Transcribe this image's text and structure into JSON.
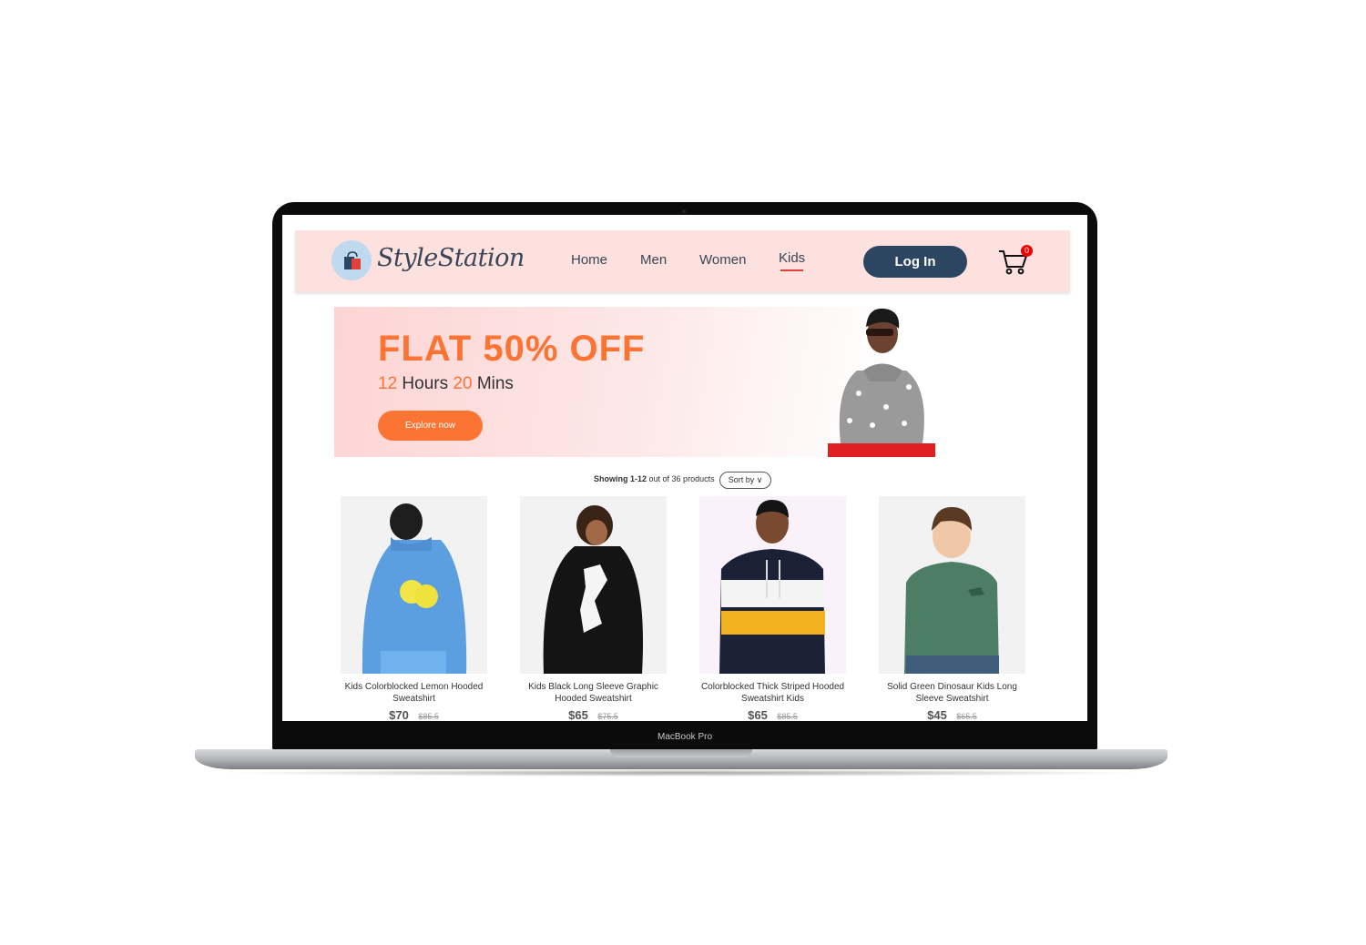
{
  "device": {
    "label": "MacBook Pro"
  },
  "navbar": {
    "brand": "StyleStation",
    "links": [
      {
        "label": "Home",
        "active": false
      },
      {
        "label": "Men",
        "active": false
      },
      {
        "label": "Women",
        "active": false
      },
      {
        "label": "Kids",
        "active": true
      }
    ],
    "login_label": "Log In",
    "cart_count": "0"
  },
  "banner": {
    "title": "FLAT 50% OFF",
    "hours": "12",
    "hours_label": "Hours",
    "mins": "20",
    "mins_label": "Mins",
    "cta": "Explore now"
  },
  "listing": {
    "showing_bold": "Showing 1-12",
    "showing_rest": "out of 36 products",
    "sort_label": "Sort by"
  },
  "products": [
    {
      "name": "Kids Colorblocked Lemon Hooded Sweatshirt",
      "price": "$70",
      "old_price": "$85.5"
    },
    {
      "name": "Kids Black Long Sleeve Graphic Hooded Sweatshirt",
      "price": "$65",
      "old_price": "$75.5"
    },
    {
      "name": "Colorblocked Thick Striped Hooded Sweatshirt Kids",
      "price": "$65",
      "old_price": "$85.5"
    },
    {
      "name": "Solid Green Dinosaur Kids Long Sleeve Sweatshirt",
      "price": "$45",
      "old_price": "$65.5"
    }
  ],
  "colors": {
    "accent": "#fb7434",
    "navy": "#2c4560",
    "navbar_bg": "#fde1df",
    "active_underline": "#e0403a"
  }
}
